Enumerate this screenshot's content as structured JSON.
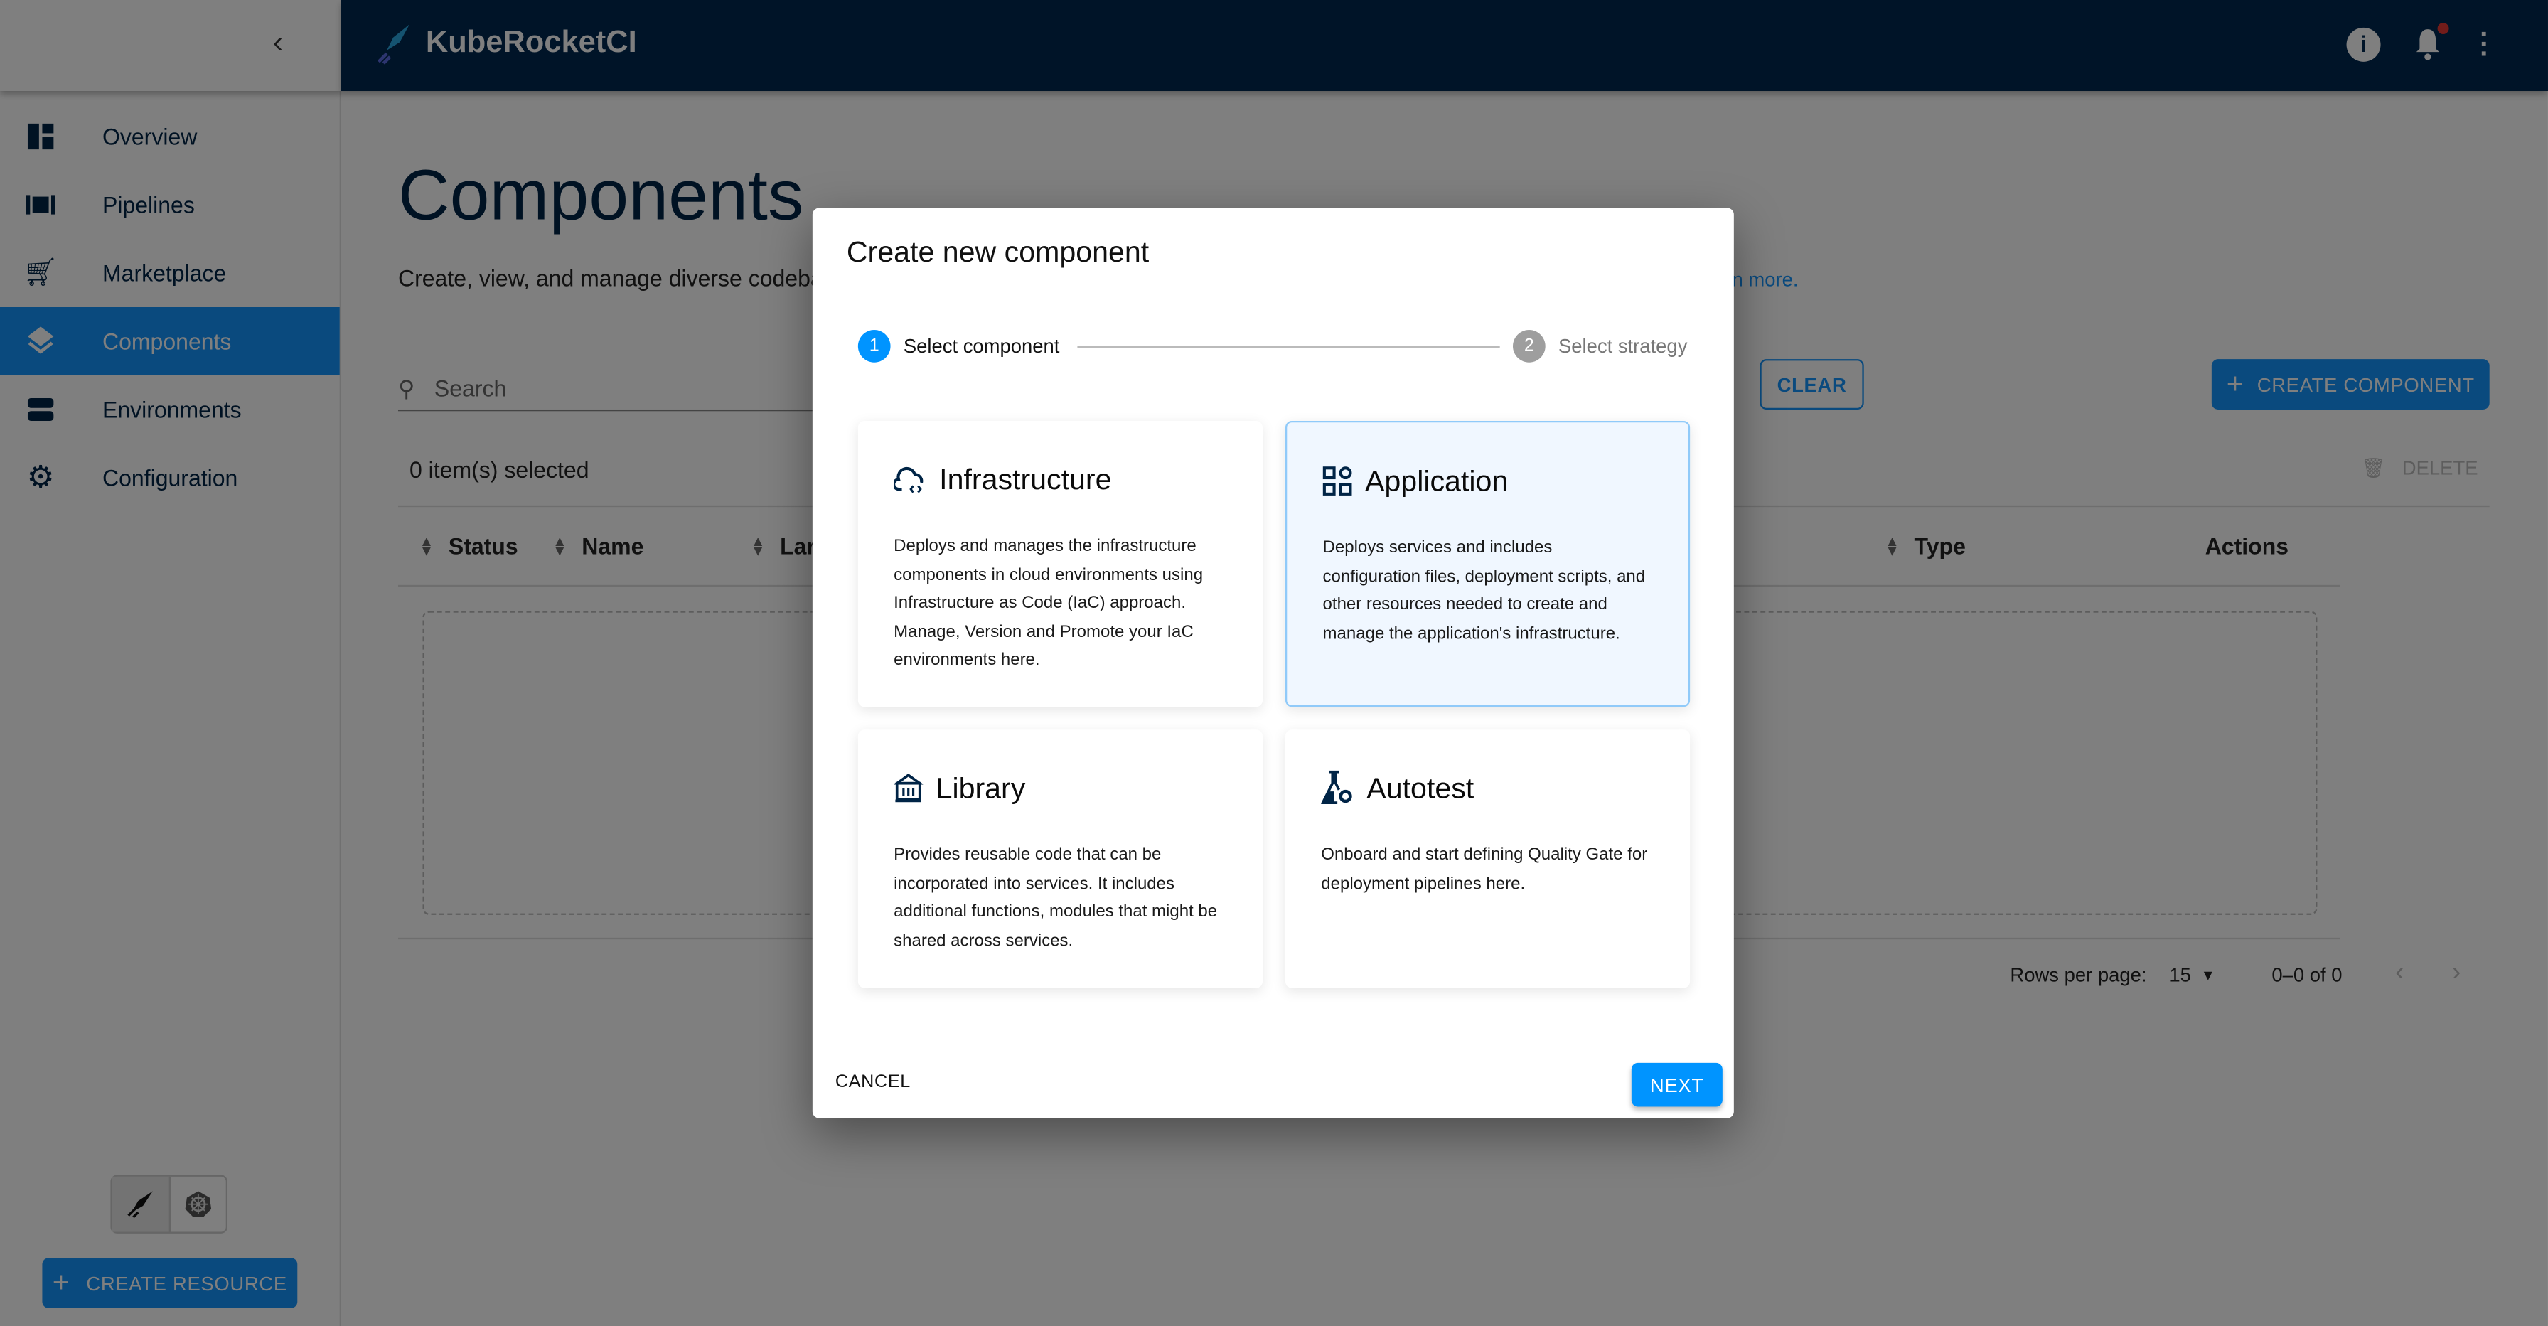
{
  "app": {
    "title": "KubeRocketCI"
  },
  "sidebar": {
    "items": [
      {
        "label": "Overview",
        "icon": "dashboard-icon"
      },
      {
        "label": "Pipelines",
        "icon": "pipelines-icon"
      },
      {
        "label": "Marketplace",
        "icon": "cart-icon"
      },
      {
        "label": "Components",
        "icon": "layers-icon",
        "active": true
      },
      {
        "label": "Environments",
        "icon": "environments-icon"
      },
      {
        "label": "Configuration",
        "icon": "gear-icon"
      }
    ],
    "create_resource": "CREATE RESOURCE",
    "mode_toggle": [
      "krci-mode",
      "kubernetes-mode"
    ]
  },
  "page": {
    "title": "Components",
    "subtitle": "Create, view, and manage diverse codeba",
    "learn_more": "n more.",
    "search_placeholder": "Search",
    "clear": "CLEAR",
    "create_component": "CREATE COMPONENT",
    "selected": "0 item(s) selected",
    "delete": "DELETE",
    "columns": [
      "Status",
      "Name",
      "Lar",
      "Type",
      "Actions"
    ],
    "pagination": {
      "rows_per_page_label": "Rows per page:",
      "rows_per_page": "15",
      "range": "0–0 of 0"
    }
  },
  "colors": {
    "accent": "#0094ff",
    "header": "#002850",
    "active_nav": "#1494fc"
  },
  "modal": {
    "title": "Create new component",
    "steps": [
      {
        "num": "1",
        "label": "Select component",
        "active": true
      },
      {
        "num": "2",
        "label": "Select strategy",
        "active": false
      }
    ],
    "cards": [
      {
        "title": "Infrastructure",
        "icon": "cloud-code-icon",
        "desc": "Deploys and manages the infrastructure components in cloud environments using Infrastructure as Code (IaC) approach. Manage, Version and Promote your IaC environments here.",
        "selected": false
      },
      {
        "title": "Application",
        "icon": "apps-grid-icon",
        "desc": "Deploys services and includes configuration files, deployment scripts, and other resources needed to create and manage the application's infrastructure.",
        "selected": true
      },
      {
        "title": "Library",
        "icon": "library-icon",
        "desc": "Provides reusable code that can be incorporated into services. It includes additional functions, modules that might be shared across services.",
        "selected": false
      },
      {
        "title": "Autotest",
        "icon": "flask-gear-icon",
        "desc": "Onboard and start defining Quality Gate for deployment pipelines here.",
        "selected": false
      }
    ],
    "cancel": "CANCEL",
    "next": "NEXT"
  }
}
